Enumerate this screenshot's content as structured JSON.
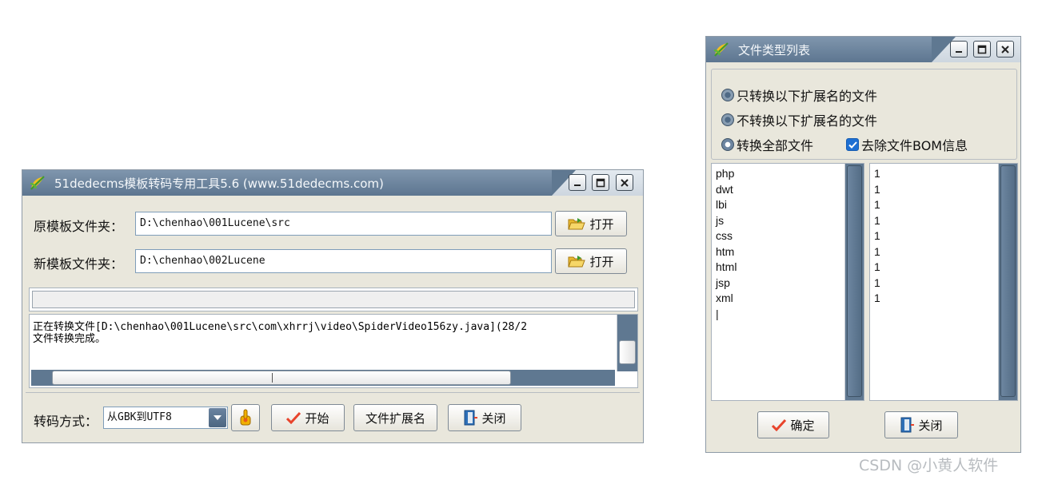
{
  "main_window": {
    "title": "51dedecms模板转码专用工具5.6  (www.51dedecms.com)",
    "source_label": "原模板文件夹：",
    "source_value": "D:\\chenhao\\001Lucene\\src",
    "target_label": "新模板文件夹：",
    "target_value": "D:\\chenhao\\002Lucene",
    "open_label": "打开",
    "progress_fraction": 0.0,
    "log_lines": [
      "正在转换文件[D:\\chenhao\\001Lucene\\src\\com\\xhrrj\\video\\SpiderVideo156zy.java](28/2",
      "文件转换完成。"
    ],
    "encoding_label": "转码方式：",
    "encoding_value": "从GBK到UTF8",
    "start_label": "开始",
    "ext_label": "文件扩展名",
    "close_label": "关闭"
  },
  "types_window": {
    "title": "文件类型列表",
    "options": {
      "only_listed": "只转换以下扩展名的文件",
      "exclude_listed": "不转换以下扩展名的文件",
      "convert_all": "转换全部文件",
      "remove_bom": "去除文件BOM信息"
    },
    "extensions": "php\ndwt\nlbi\njs\ncss\nhtm\nhtml\njsp\nxml\n|",
    "flags": "1\n1\n1\n1\n1\n1\n1\n1\n1",
    "ok_label": "确定",
    "close_label": "关闭"
  },
  "watermark": "CSDN @小黄人软件",
  "colors": {
    "title_bar": "#5f7891",
    "window_face": "#e9e7dc",
    "checkbox": "#1d6fd3",
    "check_mark": "#e8442c"
  },
  "icons": [
    "app-leaf-icon",
    "minimize-icon",
    "maximize-icon",
    "close-icon",
    "folder-open-icon",
    "settings-hand-icon",
    "checkmark-icon",
    "door-exit-icon"
  ]
}
